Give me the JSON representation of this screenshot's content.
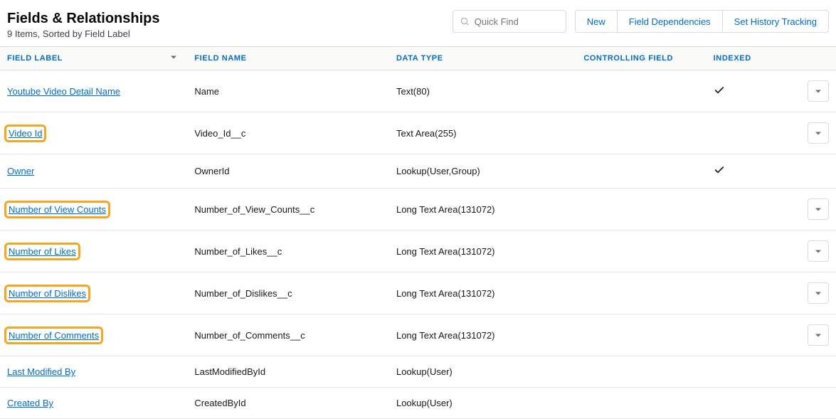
{
  "header": {
    "title": "Fields & Relationships",
    "subtitle": "9 Items, Sorted by Field Label",
    "search_placeholder": "Quick Find",
    "buttons": {
      "new": "New",
      "deps": "Field Dependencies",
      "history": "Set History Tracking"
    }
  },
  "columns": {
    "label": "FIELD LABEL",
    "name": "FIELD NAME",
    "type": "DATA TYPE",
    "ctrl": "CONTROLLING FIELD",
    "indexed": "INDEXED"
  },
  "rows": [
    {
      "label": "Youtube Video Detail Name",
      "name": "Name",
      "type": "Text(80)",
      "indexed": true,
      "has_action": true,
      "highlight": false
    },
    {
      "label": "Video Id",
      "name": "Video_Id__c",
      "type": "Text Area(255)",
      "indexed": false,
      "has_action": true,
      "highlight": true
    },
    {
      "label": "Owner",
      "name": "OwnerId",
      "type": "Lookup(User,Group)",
      "indexed": true,
      "has_action": false,
      "highlight": false
    },
    {
      "label": "Number of View Counts",
      "name": "Number_of_View_Counts__c",
      "type": "Long Text Area(131072)",
      "indexed": false,
      "has_action": true,
      "highlight": true
    },
    {
      "label": "Number of Likes",
      "name": "Number_of_Likes__c",
      "type": "Long Text Area(131072)",
      "indexed": false,
      "has_action": true,
      "highlight": true
    },
    {
      "label": "Number of Dislikes",
      "name": "Number_of_Dislikes__c",
      "type": "Long Text Area(131072)",
      "indexed": false,
      "has_action": true,
      "highlight": true
    },
    {
      "label": "Number of Comments",
      "name": "Number_of_Comments__c",
      "type": "Long Text Area(131072)",
      "indexed": false,
      "has_action": true,
      "highlight": true
    },
    {
      "label": "Last Modified By",
      "name": "LastModifiedById",
      "type": "Lookup(User)",
      "indexed": false,
      "has_action": false,
      "highlight": false
    },
    {
      "label": "Created By",
      "name": "CreatedById",
      "type": "Lookup(User)",
      "indexed": false,
      "has_action": false,
      "highlight": false
    }
  ]
}
